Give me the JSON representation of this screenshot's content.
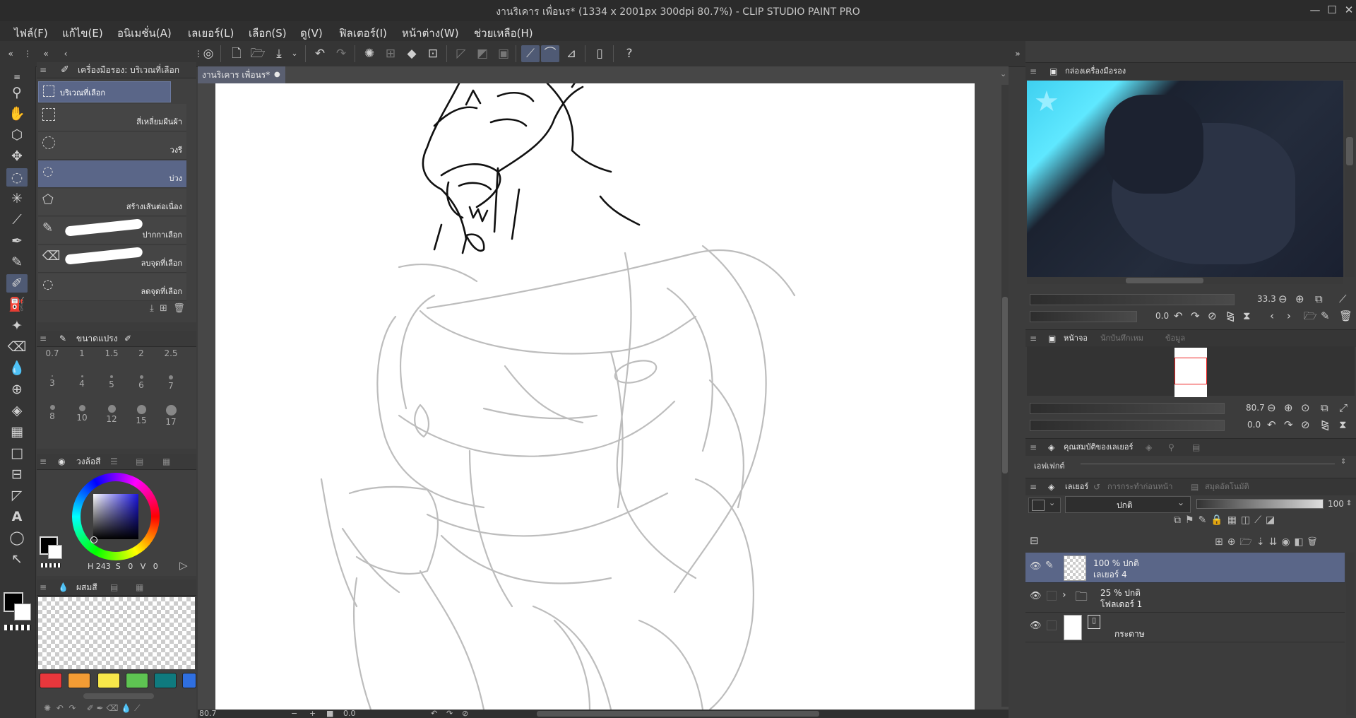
{
  "window": {
    "title": "งานริเคาร เพื่อนร* (1334 x 2001px 300dpi 80.7%)  - CLIP STUDIO PAINT PRO",
    "minimize": "—",
    "maximize": "☐",
    "close": "✕"
  },
  "menu": [
    "ไฟล์(F)",
    "แก้ไข(E)",
    "อนิเมชั่น(A)",
    "เลเยอร์(L)",
    "เลือก(S)",
    "ดู(V)",
    "ฟิลเตอร์(I)",
    "หน้าต่าง(W)",
    "ช่วยเหลือ(H)"
  ],
  "tool_property": {
    "header": "เครื่องมือรอง: บริเวณที่เลือก",
    "group": "บริเวณที่เลือก",
    "subtools": [
      "สี่เหลี่ยมผืนผ้า",
      "วงรี",
      "บ่วง",
      "สร้างเส้นต่อเนื่อง",
      "ปากกาเลือก",
      "ลบจุดที่เลือก",
      "ลดจุดที่เลือก"
    ],
    "selected_index": 2
  },
  "brush_size": {
    "tab": "ขนาดแปรง",
    "sizes": [
      "0.7",
      "1",
      "1.5",
      "2",
      "2.5",
      "3",
      "4",
      "5",
      "6",
      "7",
      "8",
      "10",
      "12",
      "15",
      "17"
    ]
  },
  "color_wheel": {
    "tab": "วงล้อสี",
    "h_label": "H",
    "h": "243",
    "s_label": "S",
    "s": "0",
    "v_label": "V",
    "v": "0"
  },
  "mixing": {
    "tab": "ผสมสี",
    "palette": [
      "#e8373c",
      "#f39c34",
      "#f7e74a",
      "#5ec452",
      "#0f7a7e",
      "#2f6fe0"
    ]
  },
  "document": {
    "tab": "งานริเคาร เพื่อนร*",
    "zoom": "80.7",
    "angle": "0.0"
  },
  "sub_view": {
    "tab": "กล่องเครื่องมือรอง",
    "zoom": "33.3",
    "angle": "0.0"
  },
  "navigator": {
    "tabs": [
      "หน้าจอ",
      "นักบันทึกเหม",
      "ข้อมูล"
    ],
    "zoom": "80.7",
    "angle": "0.0"
  },
  "layer_property": {
    "tabs": [
      "คุณสมบัติของเลเยอร์",
      "",
      ""
    ],
    "effect": "เอฟเฟกต์"
  },
  "layers": {
    "tabs": [
      "เลเยอร์",
      "การกระทำก่อนหน้า",
      "สมุดอัตโนมัติ"
    ],
    "blend_mode": "ปกติ",
    "opacity": "100",
    "list": [
      {
        "line1": "100 % ปกติ",
        "line2": "เลเยอร์ 4",
        "kind": "raster",
        "selected": true
      },
      {
        "line1": "25 % ปกติ",
        "line2": "โฟลเดอร์ 1",
        "kind": "folder",
        "selected": false
      },
      {
        "line1": "",
        "line2": "กระดาษ",
        "kind": "paper",
        "selected": false
      }
    ]
  },
  "colors": {
    "accent": "#5a6688",
    "bg": "#3c3c3c",
    "main_color": "#000000",
    "sub_color": "#ffffff"
  }
}
